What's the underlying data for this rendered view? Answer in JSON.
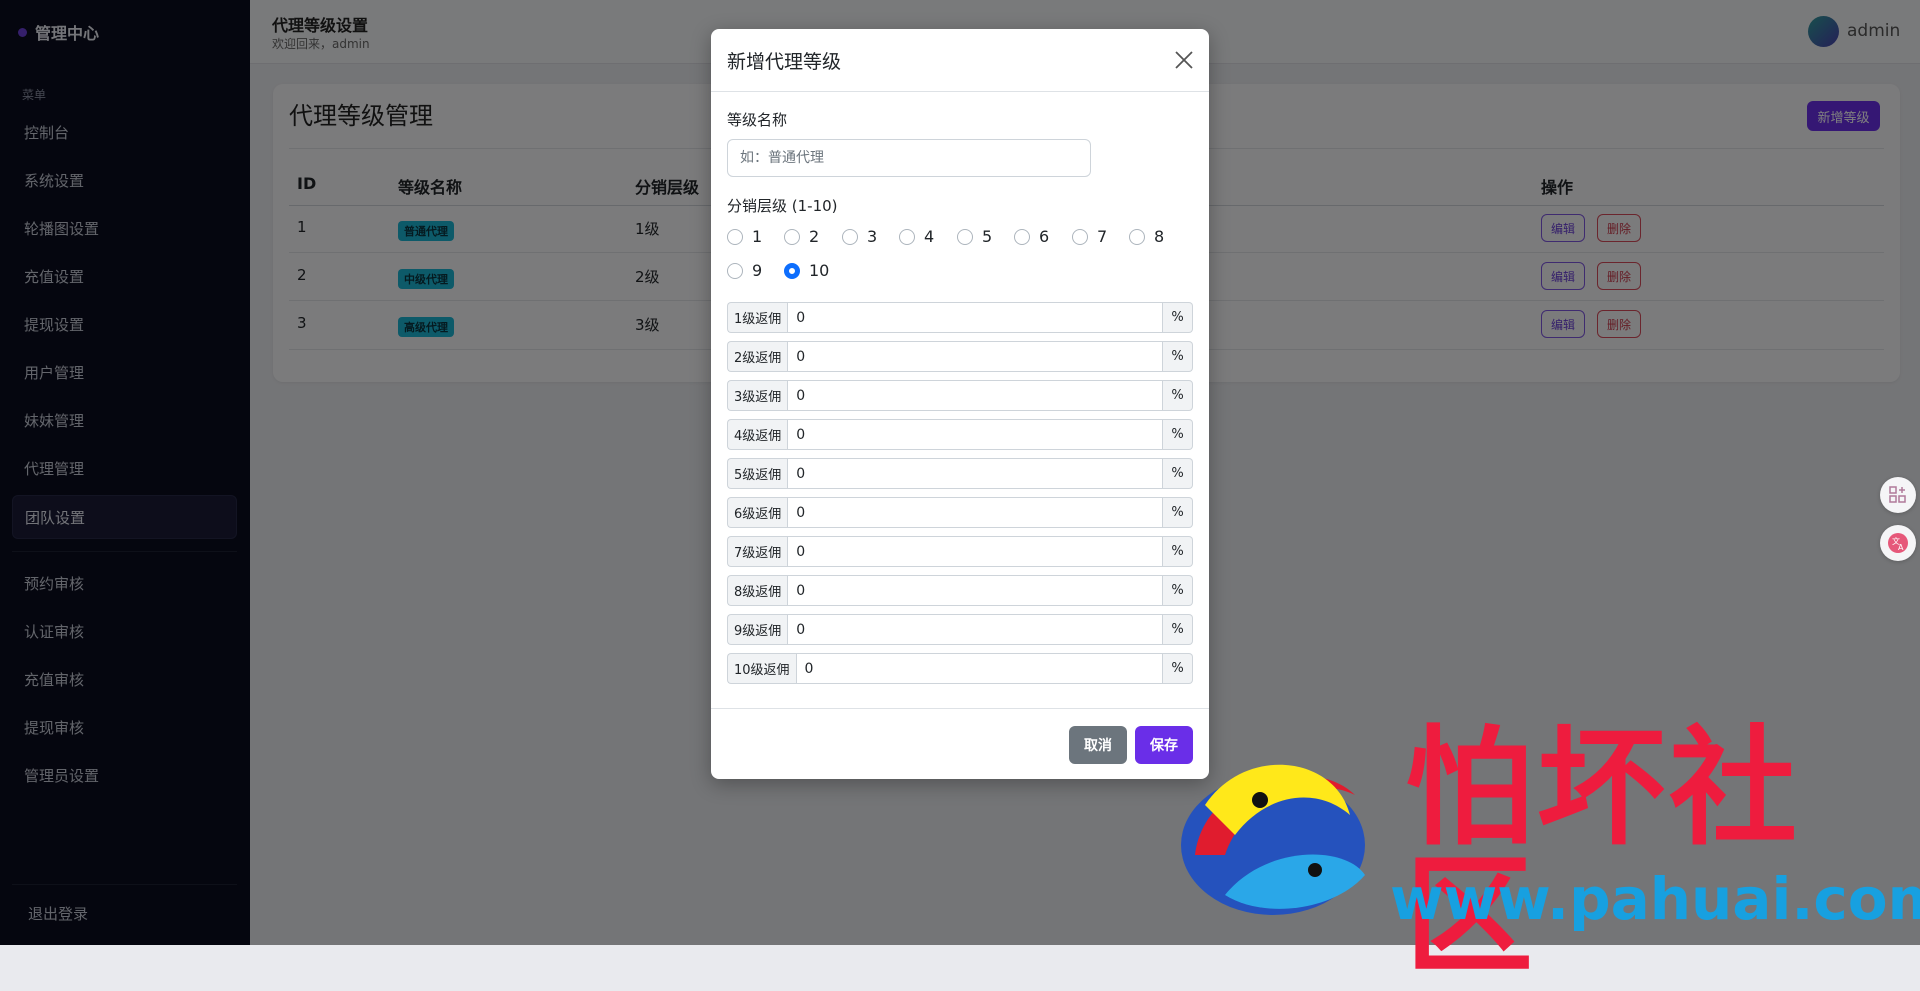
{
  "sidebar": {
    "brand": "管理中心",
    "section": "菜单",
    "items": [
      "控制台",
      "系统设置",
      "轮播图设置",
      "充值设置",
      "提现设置",
      "用户管理",
      "妹妹管理",
      "代理管理",
      "团队设置"
    ],
    "items2": [
      "预约审核",
      "认证审核",
      "充值审核",
      "提现审核",
      "管理员设置"
    ],
    "logout": "退出登录"
  },
  "header": {
    "title": "代理等级设置",
    "welcome": "欢迎回来，admin",
    "user": "admin"
  },
  "card": {
    "title": "代理等级管理",
    "new_button": "新增等级",
    "columns": {
      "id": "ID",
      "name": "等级名称",
      "level": "分销层级",
      "actions": "操作"
    },
    "rows": [
      {
        "id": "1",
        "name": "普通代理",
        "level": "1级"
      },
      {
        "id": "2",
        "name": "中级代理",
        "level": "2级"
      },
      {
        "id": "3",
        "name": "高级代理",
        "level": "3级"
      }
    ],
    "edit": "编辑",
    "delete": "删除"
  },
  "modal": {
    "title": "新增代理等级",
    "name_label": "等级名称",
    "name_placeholder": "如：普通代理",
    "level_label": "分销层级 (1-10)",
    "level_options": [
      "1",
      "2",
      "3",
      "4",
      "5",
      "6",
      "7",
      "8",
      "9",
      "10"
    ],
    "selected_level": "10",
    "rates": [
      {
        "label": "1级返佣",
        "value": "0"
      },
      {
        "label": "2级返佣",
        "value": "0"
      },
      {
        "label": "3级返佣",
        "value": "0"
      },
      {
        "label": "4级返佣",
        "value": "0"
      },
      {
        "label": "5级返佣",
        "value": "0"
      },
      {
        "label": "6级返佣",
        "value": "0"
      },
      {
        "label": "7级返佣",
        "value": "0"
      },
      {
        "label": "8级返佣",
        "value": "0"
      },
      {
        "label": "9级返佣",
        "value": "0"
      },
      {
        "label": "10级返佣",
        "value": "0"
      }
    ],
    "rate_unit": "%",
    "cancel": "取消",
    "save": "保存"
  },
  "icons": {
    "close": "close-icon",
    "float_apps": "apps-add-icon",
    "float_translate": "translate-icon"
  },
  "watermark": {
    "text": "怕坏社区",
    "url": "www.pahuai.com"
  },
  "colors": {
    "accent": "#6a2ee8",
    "sidebar_bg": "#0a0d1e",
    "badge": "#1bb5d2",
    "danger": "#d64b5a",
    "radio_checked": "#0d6efd"
  }
}
